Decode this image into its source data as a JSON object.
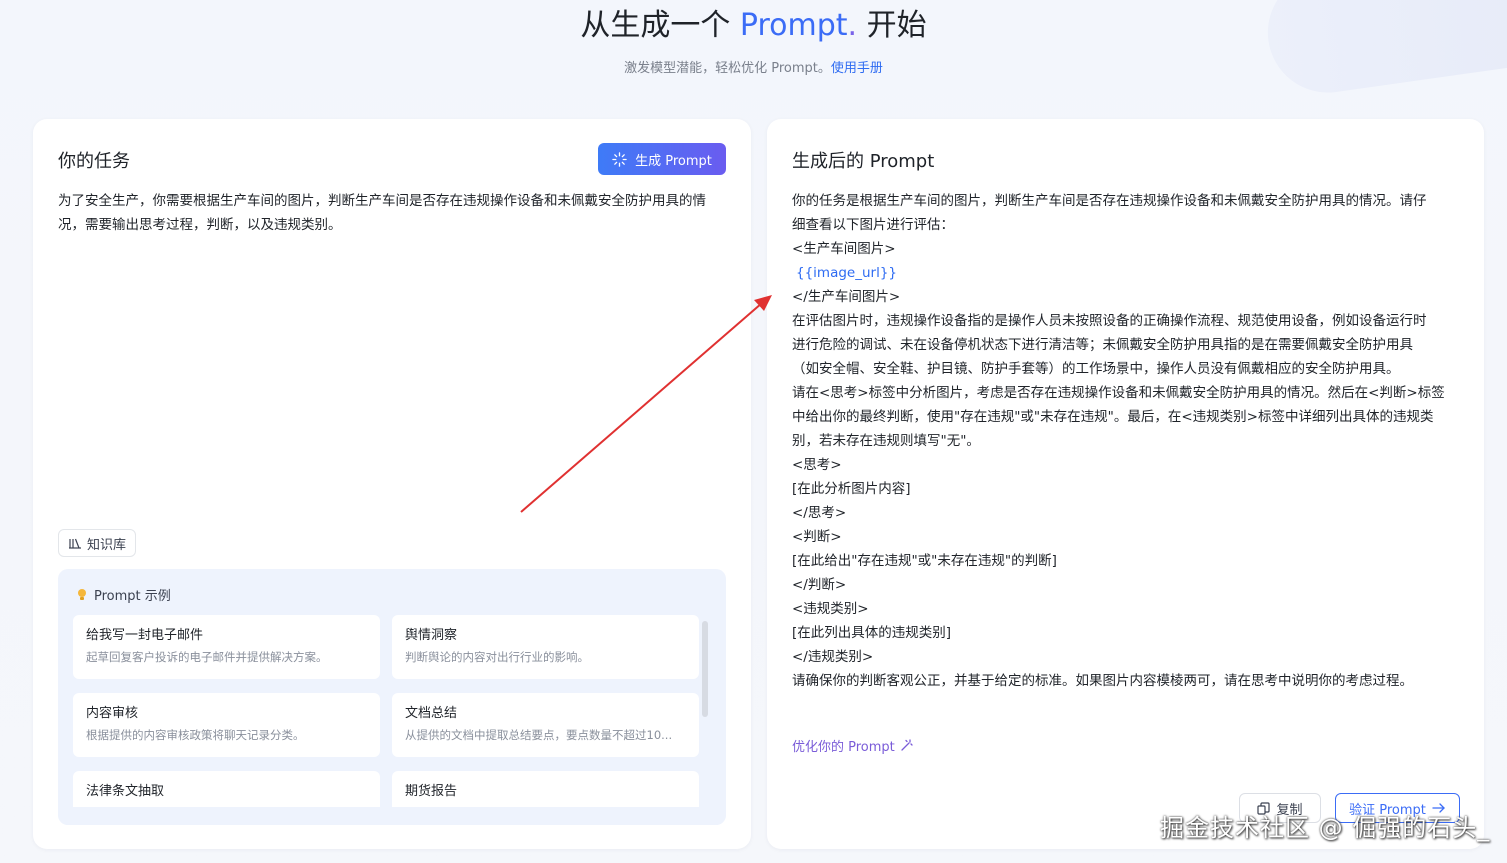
{
  "hero": {
    "title_prefix": "从生成一个 ",
    "title_accent": "Prompt",
    "title_dot": ".",
    "title_suffix": " 开始",
    "subtitle": "激发模型潜能，轻松优化 Prompt。",
    "manual_link": "使用手册"
  },
  "task_panel": {
    "title": "你的任务",
    "generate_button": "生成 Prompt",
    "task_text": "为了安全生产，你需要根据生产车间的图片，判断生产车间是否存在违规操作设备和未佩戴安全防护用具的情况，需要输出思考过程，判断，以及违规类别。",
    "knowledge_base": "知识库",
    "examples_title": "Prompt 示例",
    "examples": [
      {
        "title": "给我写一封电子邮件",
        "desc": "起草回复客户投诉的电子邮件并提供解决方案。"
      },
      {
        "title": "舆情洞察",
        "desc": "判断舆论的内容对出行行业的影响。"
      },
      {
        "title": "内容审核",
        "desc": "根据提供的内容审核政策将聊天记录分类。"
      },
      {
        "title": "文档总结",
        "desc": "从提供的文档中提取总结要点，要点数量不超过10..."
      },
      {
        "title": "法律条文抽取",
        "desc": ""
      },
      {
        "title": "期货报告",
        "desc": ""
      }
    ]
  },
  "output_panel": {
    "title": "生成后的 Prompt",
    "lines": [
      "你的任务是根据生产车间的图片，判断生产车间是否存在违规操作设备和未佩戴安全防护用具的情况。请仔",
      "细查看以下图片进行评估：",
      "<生产车间图片>",
      "{{image_url}}",
      "</生产车间图片>",
      "在评估图片时，违规操作设备指的是操作人员未按照设备的正确操作流程、规范使用设备，例如设备运行时",
      "进行危险的调试、未在设备停机状态下进行清洁等；未佩戴安全防护用具指的是在需要佩戴安全防护用具",
      "（如安全帽、安全鞋、护目镜、防护手套等）的工作场景中，操作人员没有佩戴相应的安全防护用具。",
      "请在<思考>标签中分析图片，考虑是否存在违规操作设备和未佩戴安全防护用具的情况。然后在<判断>标签",
      "中给出你的最终判断，使用\"存在违规\"或\"未存在违规\"。最后，在<违规类别>标签中详细列出具体的违规类",
      "别，若未存在违规则填写\"无\"。",
      "<思考>",
      "[在此分析图片内容]",
      "</思考>",
      "<判断>",
      "[在此给出\"存在违规\"或\"未存在违规\"的判断]",
      "</判断>",
      "<违规类别>",
      "[在此列出具体的违规类别]",
      "</违规类别>",
      "请确保你的判断客观公正，并基于给定的标准。如果图片内容模棱两可，请在思考中说明你的考虑过程。"
    ],
    "optimize_link": "优化你的 Prompt",
    "copy_button": "复制",
    "verify_button": "验证 Prompt"
  },
  "watermark": "掘金技术社区 @ 倔强的石头_",
  "colors": {
    "accent": "#3b6cf6",
    "accent_purple": "#6a5cf0",
    "annotation_arrow": "#e03131",
    "example_bg": "#eef3fd"
  }
}
